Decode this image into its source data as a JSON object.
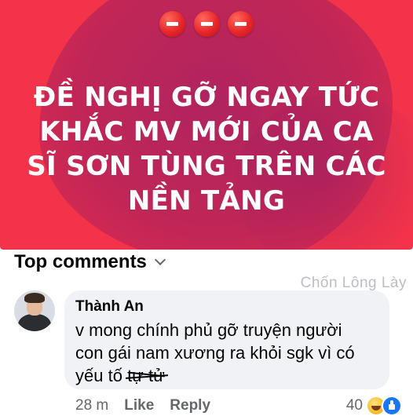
{
  "banner": {
    "emojis": [
      "no-entry-icon",
      "no-entry-icon",
      "no-entry-icon"
    ],
    "headline_lines": [
      "ĐỀ NGHỊ GỠ NGAY TỨC",
      "KHẮC MV MỚI CỦA CA",
      "SĨ SƠN TÙNG TRÊN CÁC",
      "NỀN TẢNG"
    ],
    "colors": {
      "background": "#f3334a",
      "blob": "#b0245e",
      "text": "#ffffff"
    }
  },
  "comments_section": {
    "heading": "Top comments",
    "watermark": "Chốn Lông Lày"
  },
  "comment": {
    "author": "Thành An",
    "text_lines": [
      "v mong chính phủ gỡ truyện người",
      "con gái nam xương ra khỏi sgk vì có"
    ],
    "last_line_prefix": "yếu tố",
    "scribbled_text": "tự tử",
    "time": "28 m",
    "like_label": "Like",
    "reply_label": "Reply",
    "reaction_count": "40",
    "reaction_icons": [
      "haha-icon",
      "like-icon"
    ]
  }
}
